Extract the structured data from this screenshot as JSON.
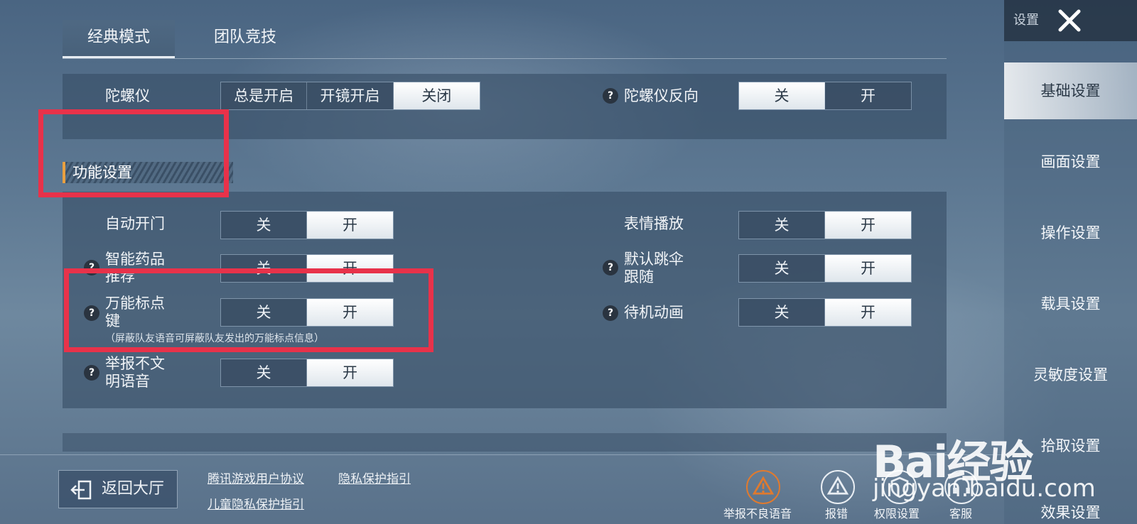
{
  "tabs": [
    {
      "label": "经典模式",
      "active": true
    },
    {
      "label": "团队竞技",
      "active": false
    }
  ],
  "gyro": {
    "label": "陀螺仪",
    "options": [
      "总是开启",
      "开镜开启",
      "关闭"
    ],
    "selected": "关闭",
    "reverse_label": "陀螺仪反向",
    "reverse_options": [
      "关",
      "开"
    ],
    "reverse_selected": "关"
  },
  "section": {
    "title": "功能设置"
  },
  "settings": {
    "auto_door": {
      "label": "自动开门",
      "off": "关",
      "on": "开",
      "selected": "开"
    },
    "smart_meds": {
      "label1": "智能药品",
      "label2": "推荐",
      "off": "关",
      "on": "开",
      "selected": "开"
    },
    "marker_key": {
      "label1": "万能标点",
      "label2": "键",
      "off": "关",
      "on": "开",
      "selected": "开",
      "hint": "（屏蔽队友语音可屏蔽队友发出的万能标点信息）"
    },
    "report_voice": {
      "label1": "举报不文",
      "label2": "明语音",
      "off": "关",
      "on": "开",
      "selected": "开"
    },
    "emote": {
      "label": "表情播放",
      "off": "关",
      "on": "开",
      "selected": "开"
    },
    "parachute": {
      "label1": "默认跳伞",
      "label2": "跟随",
      "off": "关",
      "on": "开",
      "selected": "开"
    },
    "idle_anim": {
      "label": "待机动画",
      "off": "关",
      "on": "开",
      "selected": "开"
    }
  },
  "sidebar": {
    "title": "设置",
    "items": [
      {
        "label": "基础设置",
        "active": true
      },
      {
        "label": "画面设置",
        "active": false
      },
      {
        "label": "操作设置",
        "active": false
      },
      {
        "label": "载具设置",
        "active": false
      },
      {
        "label": "灵敏度设置",
        "active": false
      },
      {
        "label": "拾取设置",
        "active": false
      },
      {
        "label": "效果设置",
        "active": false
      }
    ]
  },
  "bottom": {
    "back_label": "返回大厅",
    "links": [
      "腾讯游戏用户协议",
      "隐私保护指引",
      "儿童隐私保护指引"
    ],
    "actions": [
      "举报不良语音",
      "报错",
      "权限设置",
      "客服"
    ]
  },
  "watermark": {
    "brand": "Bai经验",
    "url": "jingyan.baidu.com"
  },
  "colors": {
    "accent": "#e9a040",
    "highlight_box": "#e8324a",
    "report_icon": "#e07a2e"
  }
}
